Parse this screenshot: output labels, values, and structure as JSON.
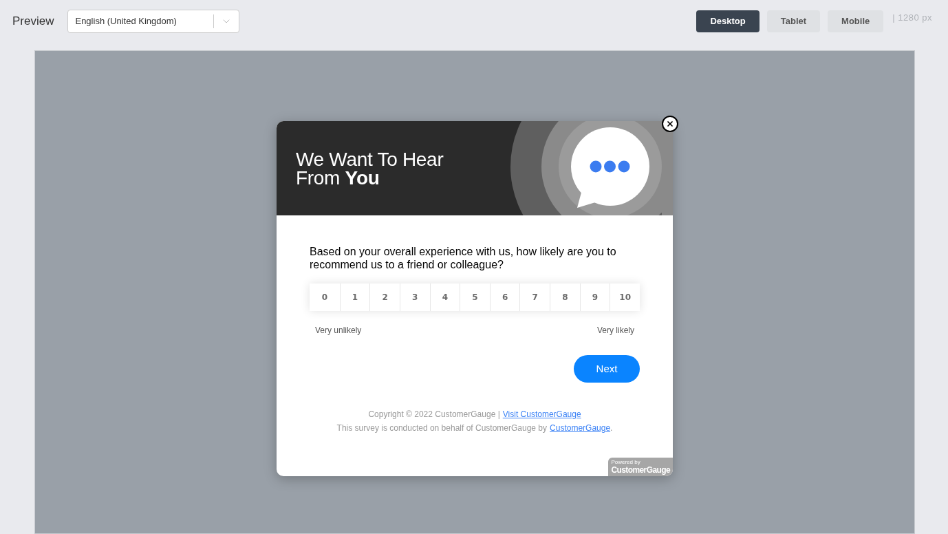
{
  "toolbar": {
    "title": "Preview",
    "language_select": {
      "value": "English (United Kingdom)"
    },
    "devices": [
      {
        "label": "Desktop",
        "selected": true
      },
      {
        "label": "Tablet",
        "selected": false
      },
      {
        "label": "Mobile",
        "selected": false
      }
    ],
    "width_readout": "| 1280 px"
  },
  "survey": {
    "header_title": "We Want To Hear From **You**",
    "question": "Based on your overall experience with us, how likely are you to recommend us to a friend or colleague?",
    "scale": [
      {
        "label": "0",
        "selected": false
      },
      {
        "label": "1",
        "selected": false
      },
      {
        "label": "2",
        "selected": false
      },
      {
        "label": "3",
        "selected": false
      },
      {
        "label": "4",
        "selected": false
      },
      {
        "label": "5",
        "selected": false
      },
      {
        "label": "6",
        "selected": false
      },
      {
        "label": "7",
        "selected": false
      },
      {
        "label": "8",
        "selected": false
      },
      {
        "label": "9",
        "selected": false
      },
      {
        "label": "10",
        "selected": false
      }
    ],
    "low_label": "Very unlikely",
    "high_label": "Very likely",
    "next_button": "Next",
    "footer": {
      "copyright": "Copyright © 2022 CustomerGauge |",
      "copyright_link": "Visit CustomerGauge",
      "disclaimer": "This survey is conducted on behalf of CustomerGauge by",
      "disclaimer_link": "CustomerGauge",
      "disclaimer_end": "."
    },
    "badge": {
      "line_1": "Powered by",
      "line_2": "CustomerGauge"
    }
  }
}
